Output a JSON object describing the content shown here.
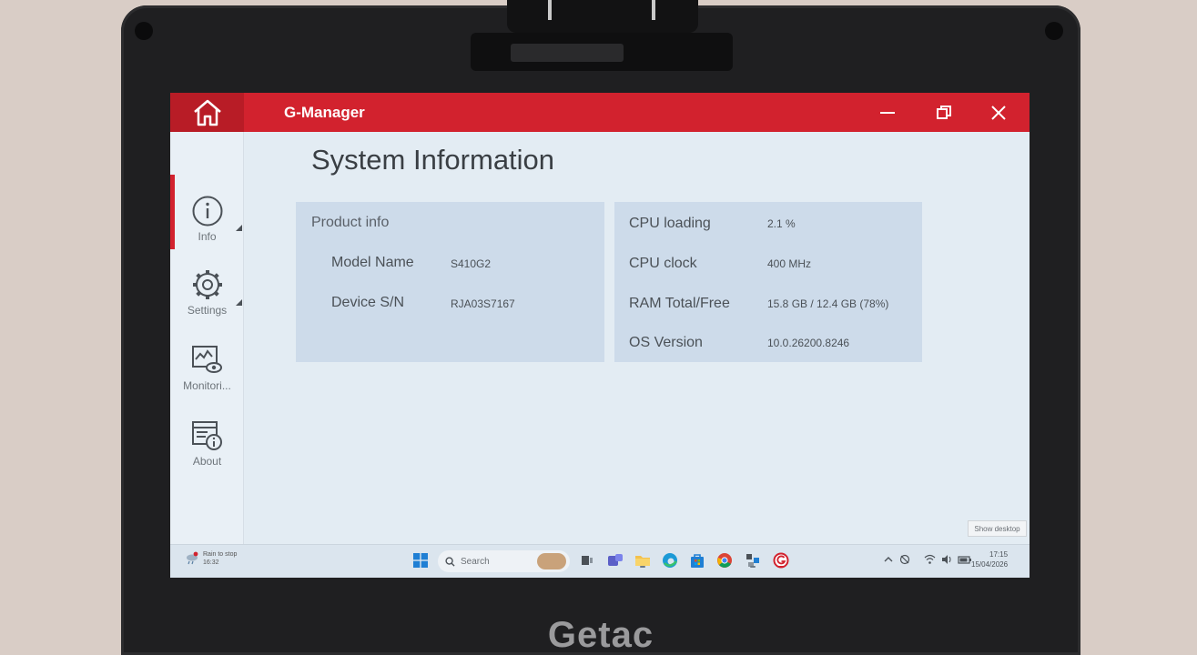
{
  "device": {
    "brand": "Getac"
  },
  "window": {
    "title": "G-Manager",
    "home_icon": "home-icon",
    "minimize_icon": "minimize-icon",
    "restore_icon": "restore-icon",
    "close_icon": "close-icon",
    "accent": "#d2222e"
  },
  "sidebar": {
    "items": [
      {
        "label": "Info",
        "icon": "info-icon",
        "active": true
      },
      {
        "label": "Settings",
        "icon": "gear-icon",
        "active": false
      },
      {
        "label": "Monitori...",
        "icon": "monitoring-icon",
        "active": false
      },
      {
        "label": "About",
        "icon": "about-icon",
        "active": false
      }
    ]
  },
  "page": {
    "title": "System Information",
    "product": {
      "heading": "Product info",
      "rows": [
        {
          "label": "Model Name",
          "value": "S410G2"
        },
        {
          "label": "Device S/N",
          "value": "RJA03S7167"
        }
      ]
    },
    "stats": {
      "rows": [
        {
          "label": "CPU loading",
          "value": "2.1 %"
        },
        {
          "label": "CPU clock",
          "value": "400 MHz"
        },
        {
          "label": "RAM Total/Free",
          "value": "15.8 GB / 12.4 GB (78%)"
        },
        {
          "label": "OS Version",
          "value": "10.0.26200.8246"
        }
      ]
    }
  },
  "tooltip": "Show desktop",
  "taskbar": {
    "weather": {
      "line1": "Rain to stop",
      "line2": "16:32"
    },
    "search_placeholder": "Search",
    "clock": {
      "time": "17:15",
      "date": "15/04/2026"
    }
  }
}
